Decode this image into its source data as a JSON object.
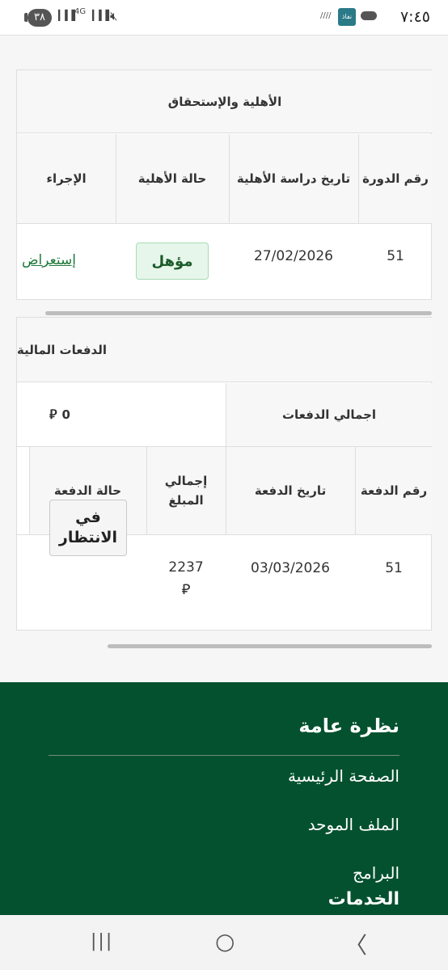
{
  "status_bar": {
    "time": "٧:٤٥",
    "battery": "٣٨",
    "network": "4G",
    "nafath_label": "نفاذ"
  },
  "eligibility": {
    "title": "الأهلية والإستحقاق",
    "columns": [
      "رقم الدورة",
      "تاريخ دراسة الأهلية",
      "حالة الأهلية",
      "الإجراء"
    ],
    "row": {
      "cycle_number": "51",
      "study_date": "27/02/2026",
      "status": "مؤهل",
      "action": "إستعراض"
    }
  },
  "payments": {
    "title": "الدفعات المالية",
    "total_label": "اجمالي الدفعات",
    "total_value": "0",
    "currency_symbol": "⃁",
    "columns": [
      "رقم الدفعة",
      "تاريخ الدفعة",
      "إجمالي المبلغ",
      "حالة الدفعة"
    ],
    "row": {
      "payment_number": "51",
      "payment_date": "03/03/2026",
      "amount": "2237",
      "status": "في الانتظار"
    }
  },
  "footer": {
    "overview_title": "نظرة عامة",
    "links": [
      "الصفحة الرئيسية",
      "الملف الموحد",
      "البرامج"
    ],
    "services_title": "الخدمات"
  },
  "nav": {
    "recent": "|||",
    "home": "○",
    "back": "〈"
  }
}
